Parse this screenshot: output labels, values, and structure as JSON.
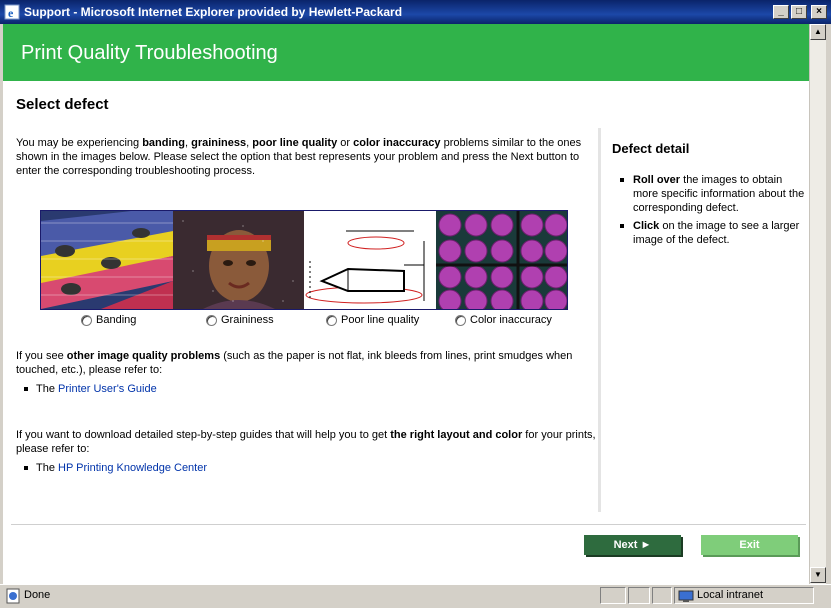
{
  "window": {
    "title": "Support - Microsoft Internet Explorer provided by Hewlett-Packard"
  },
  "banner": {
    "title": "Print Quality Troubleshooting"
  },
  "main": {
    "heading": "Select defect",
    "intro": {
      "t1": "You may be experiencing ",
      "b1": "banding",
      "t2": ", ",
      "b2": "graininess",
      "t3": ", ",
      "b3": "poor line quality",
      "t4": " or ",
      "b4": "color inaccuracy",
      "t5": " problems similar to the ones shown in the images below. Please select the option that best represents your problem and press the Next button to enter the corresponding troubleshooting process."
    },
    "defects": [
      {
        "label": "Banding"
      },
      {
        "label": "Graininess"
      },
      {
        "label": "Poor line quality"
      },
      {
        "label": "Color inaccuracy"
      }
    ],
    "other": {
      "t1": "If you see ",
      "b1": "other image quality problems",
      "t2": " (such as the paper is not flat, ink bleeds from lines, print smudges when touched, etc.), please refer to:",
      "bullet_prefix": "The ",
      "link": "Printer User's Guide"
    },
    "download": {
      "t1": "If you want to download detailed step-by-step guides that will help you to get ",
      "b1": "the right layout and color",
      "t2": " for your prints, please refer to:",
      "bullet_prefix": "The ",
      "link": "HP Printing Knowledge Center"
    }
  },
  "panel": {
    "title": "Defect detail",
    "items": [
      {
        "bold": "Roll over",
        "text": " the images to obtain more specific information about the corresponding defect."
      },
      {
        "bold": "Click",
        "text": " on the image to see a larger image of the defect."
      }
    ]
  },
  "buttons": {
    "next": "Next ►",
    "exit": "Exit"
  },
  "status": {
    "text": "Done",
    "zone": "Local intranet"
  },
  "colors": {
    "banner": "#30b34a",
    "next_button": "#2e6b3e",
    "exit_button": "#7fcd7a",
    "link": "#0033aa"
  }
}
